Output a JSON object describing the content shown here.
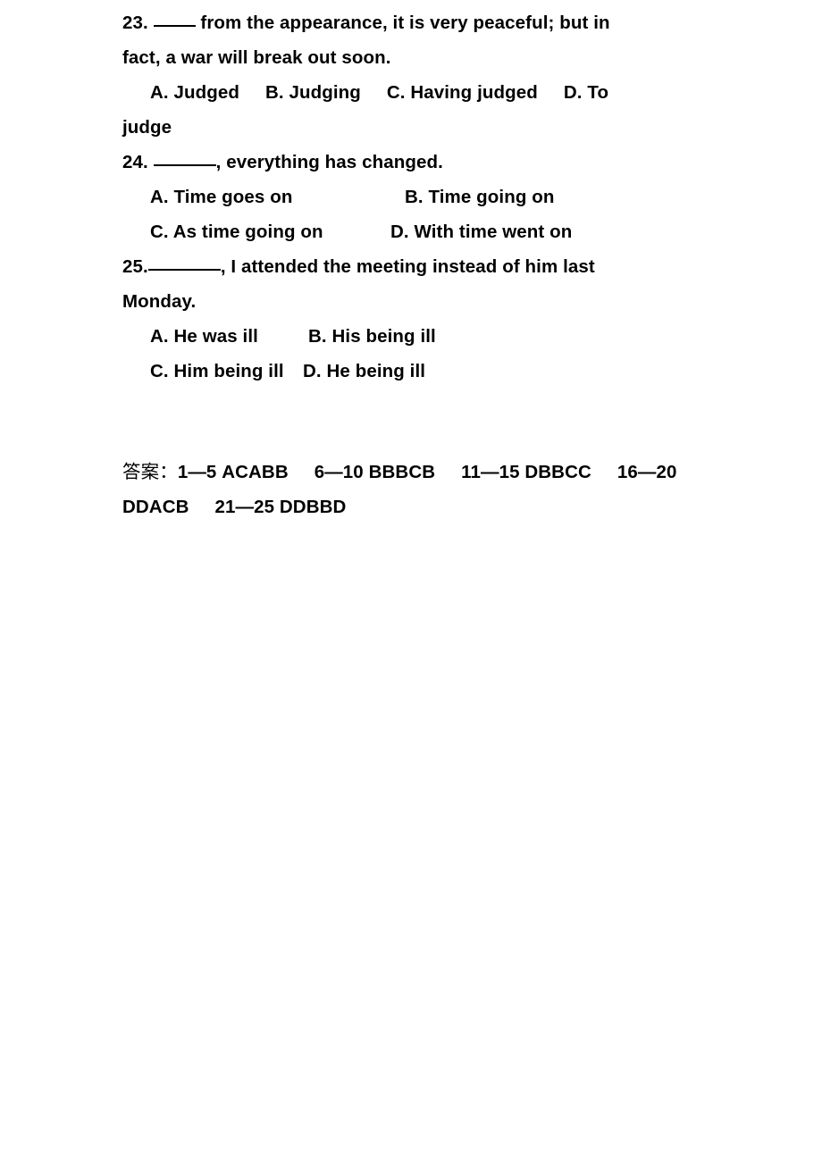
{
  "document": {
    "page_background": "#ffffff",
    "text_color": "#000000",
    "questions": [
      {
        "number": "23.",
        "blank": "____",
        "stem_after_blank": " from the appearance, it is very peaceful; but in",
        "stem_line2": "fact, a war will break out soon.",
        "options_line1": "A. Judged     B. Judging     C. Having judged     D. To",
        "options_line2": "judge"
      },
      {
        "number": "24.",
        "blank": "______",
        "stem_after_blank": ", everything has changed.",
        "option_a": "A. Time goes on",
        "option_b": "B. Time going on",
        "option_c": "C. As time going on",
        "option_d": "D. With time went on"
      },
      {
        "number": "25.",
        "blank": "_______",
        "stem_after_blank": ", I attended the meeting instead of him last",
        "stem_line2": "Monday.",
        "option_a": "A. He was ill",
        "option_b": "B. His being ill",
        "option_c": "C. Him being ill",
        "option_d": "D. He being ill"
      }
    ],
    "answer_key": {
      "label": "答案：",
      "line1": "1—5 ACABB     6—10 BBBCB     11—15 DBBCC     16—20",
      "line2": "DDACB     21—25 DDBBD",
      "groups": [
        {
          "range": "1—5",
          "answers": "ACABB"
        },
        {
          "range": "6—10",
          "answers": "BBBCB"
        },
        {
          "range": "11—15",
          "answers": "DBBCC"
        },
        {
          "range": "16—20",
          "answers": "DDACB"
        },
        {
          "range": "21—25",
          "answers": "DDBBD"
        }
      ]
    }
  }
}
